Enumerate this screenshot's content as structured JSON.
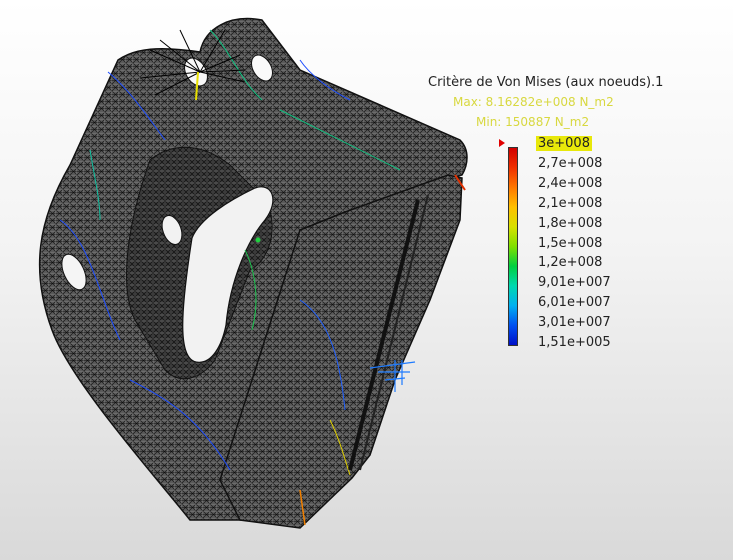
{
  "legend": {
    "title": "Critère de Von Mises (aux noeuds).1",
    "max_label": "Max: 8.16282e+008 N_m2",
    "min_label": "Min: 150887 N_m2",
    "max_color": "#d8d840",
    "min_color": "#d8d840",
    "ticks": [
      {
        "label": "3e+008",
        "color": "#d20000",
        "highlight": true
      },
      {
        "label": "2,7e+008",
        "color": "#f03000"
      },
      {
        "label": "2,4e+008",
        "color": "#ff7800"
      },
      {
        "label": "2,1e+008",
        "color": "#ffc000"
      },
      {
        "label": "1,8e+008",
        "color": "#d8e000"
      },
      {
        "label": "1,5e+008",
        "color": "#80e000"
      },
      {
        "label": "1,2e+008",
        "color": "#00d040"
      },
      {
        "label": "9,01e+007",
        "color": "#00d8b0"
      },
      {
        "label": "6,01e+007",
        "color": "#00b0f0"
      },
      {
        "label": "3,01e+007",
        "color": "#0050f0"
      },
      {
        "label": "1,51e+005",
        "color": "#0010c8"
      }
    ]
  },
  "model": {
    "mesh_color": "#2b2b2b",
    "background_top": "#ffffff",
    "background_bottom": "#d9d9d9"
  }
}
